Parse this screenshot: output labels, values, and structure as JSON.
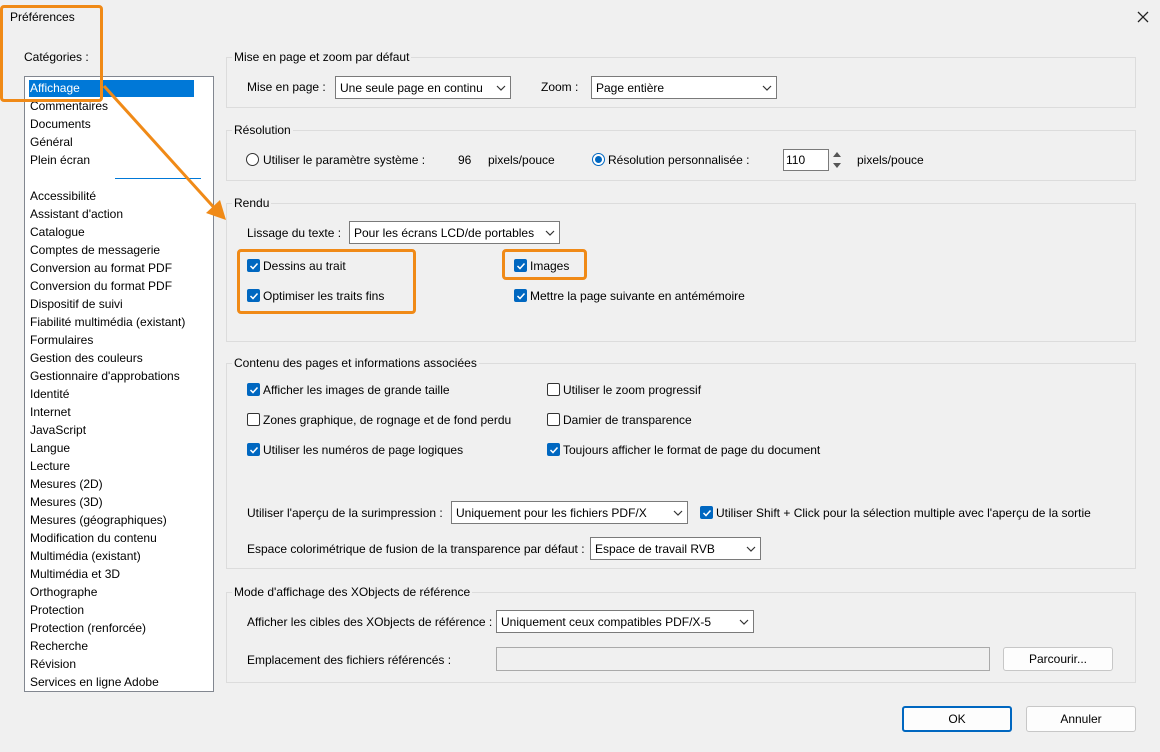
{
  "window": {
    "title": "Préférences"
  },
  "categories": {
    "label": "Catégories :",
    "top_items": [
      "Affichage",
      "Commentaires",
      "Documents",
      "Général",
      "Plein écran"
    ],
    "items": [
      "Accessibilité",
      "Assistant d'action",
      "Catalogue",
      "Comptes de messagerie",
      "Conversion au format PDF",
      "Conversion du format PDF",
      "Dispositif de suivi",
      "Fiabilité multimédia (existant)",
      "Formulaires",
      "Gestion des couleurs",
      "Gestionnaire d'approbations",
      "Identité",
      "Internet",
      "JavaScript",
      "Langue",
      "Lecture",
      "Mesures (2D)",
      "Mesures (3D)",
      "Mesures (géographiques)",
      "Modification du contenu",
      "Multimédia (existant)",
      "Multimédia et 3D",
      "Orthographe",
      "Protection",
      "Protection (renforcée)",
      "Recherche",
      "Révision",
      "Services en ligne Adobe"
    ]
  },
  "layout_zoom": {
    "title": "Mise en page et zoom par défaut",
    "page_layout_label": "Mise en page :",
    "page_layout_value": "Une seule page en continu",
    "zoom_label": "Zoom :",
    "zoom_value": "Page entière"
  },
  "resolution": {
    "title": "Résolution",
    "system_label": "Utiliser le paramètre système :",
    "system_value": "96",
    "system_unit": "pixels/pouce",
    "custom_label": "Résolution personnalisée :",
    "custom_value": "110",
    "custom_unit": "pixels/pouce"
  },
  "rendering": {
    "title": "Rendu",
    "smoothing_label": "Lissage du texte :",
    "smoothing_value": "Pour les écrans LCD/de portables",
    "line_art": "Dessins au trait",
    "thin_lines": "Optimiser les traits fins",
    "images": "Images",
    "cache_next_page": "Mettre la page suivante en antémémoire"
  },
  "page_content": {
    "title": "Contenu des pages et informations associées",
    "large_images": "Afficher les images de grande taille",
    "smooth_zoom": "Utiliser le zoom progressif",
    "art_trim_bleed": "Zones graphique, de rognage et de fond perdu",
    "transparency_grid": "Damier de transparence",
    "logical_page_numbers": "Utiliser les numéros de page logiques",
    "always_show_page_size": "Toujours afficher le format de page du document",
    "overprint_label": "Utiliser l'aperçu de la surimpression :",
    "overprint_value": "Uniquement pour les fichiers PDF/X",
    "shift_click": "Utiliser Shift + Click pour la sélection multiple avec l'aperçu de la sortie",
    "blend_label": "Espace colorimétrique de fusion de la transparence par défaut :",
    "blend_value": "Espace de travail RVB"
  },
  "xobjects": {
    "title": "Mode d'affichage des XObjects de référence",
    "targets_label": "Afficher les cibles des XObjects de référence :",
    "targets_value": "Uniquement ceux compatibles PDF/X-5",
    "location_label": "Emplacement des fichiers référencés :",
    "location_value": "",
    "browse_button": "Parcourir..."
  },
  "footer": {
    "ok": "OK",
    "cancel": "Annuler"
  },
  "colors": {
    "accent": "#0067c0",
    "selection": "#0078d7",
    "highlight": "#f08a17"
  }
}
